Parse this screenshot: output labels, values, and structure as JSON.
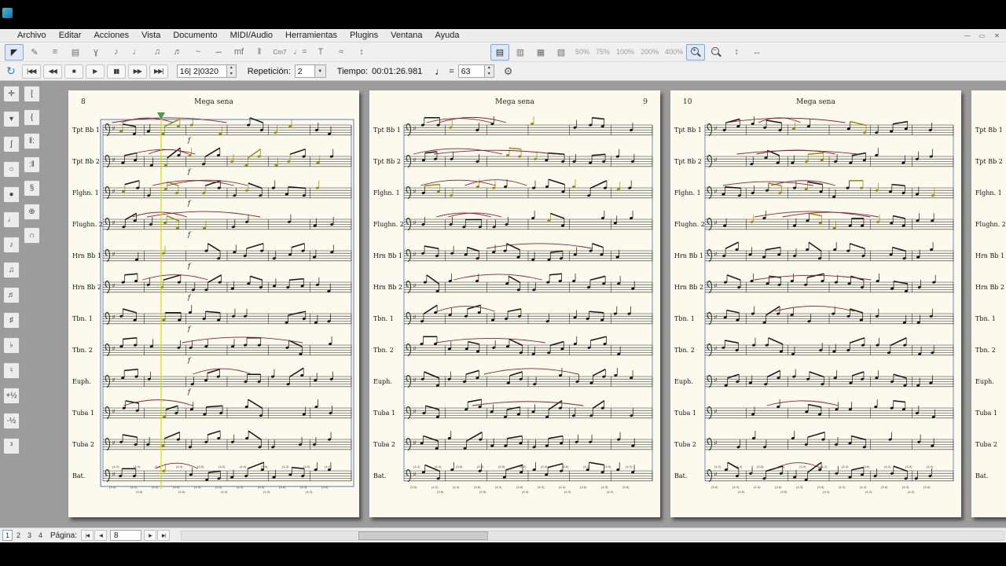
{
  "colors": {
    "accent": "#3d7bd7",
    "slur": "#8b2030",
    "note_highlight": "#9b8b00",
    "cursor_line": "#d6de00",
    "cursor_marker": "#3aa53a",
    "page_bg": "#fbfaec",
    "canvas_bg": "#9c9c9c"
  },
  "window": {
    "controls": [
      {
        "name": "minimize-button",
        "glyph": "—"
      },
      {
        "name": "restore-button",
        "glyph": "▭"
      },
      {
        "name": "close-button",
        "glyph": "✕"
      }
    ]
  },
  "menu": {
    "items": [
      "Archivo",
      "Editar",
      "Acciones",
      "Vista",
      "Documento",
      "MIDI/Audio",
      "Herramientas",
      "Plugins",
      "Ventana",
      "Ayuda"
    ]
  },
  "toolbar_main": {
    "left_icons": [
      {
        "name": "select-tool",
        "glyph": "◤",
        "active": true
      },
      {
        "name": "insert-tool",
        "glyph": "✎"
      },
      {
        "name": "align-tool",
        "glyph": "≡"
      },
      {
        "name": "staff-tool",
        "glyph": "▤"
      },
      {
        "name": "rest-tool",
        "glyph": "ɣ"
      },
      {
        "name": "note-tool",
        "glyph": "♪"
      },
      {
        "name": "grace-note-tool",
        "glyph": "♩"
      },
      {
        "name": "beam-tool",
        "glyph": "♫"
      },
      {
        "name": "tuplet-tool",
        "glyph": "♬"
      },
      {
        "name": "slur-tool",
        "glyph": "~"
      },
      {
        "name": "ornament-tool",
        "glyph": "∽"
      },
      {
        "name": "dynamics-tool",
        "glyph": "mf"
      },
      {
        "name": "barline-tool",
        "glyph": "‖"
      },
      {
        "name": "chord-tool",
        "glyph": "Cm7"
      },
      {
        "name": "tempo-tool",
        "glyph": "♩="
      },
      {
        "name": "text-tool",
        "glyph": "T"
      },
      {
        "name": "glissando-tool",
        "glyph": "≈"
      },
      {
        "name": "anchor-tool",
        "glyph": "↕"
      }
    ],
    "view_icons": [
      {
        "name": "score-layout-icon",
        "glyph": "▤",
        "active": true
      },
      {
        "name": "mixer-icon",
        "glyph": "▥"
      },
      {
        "name": "staff-view-icon",
        "glyph": "▦"
      },
      {
        "name": "page-view-icon",
        "glyph": "▧"
      }
    ],
    "zoom_presets": [
      "50%",
      "75%",
      "100%",
      "200%",
      "400%"
    ],
    "zoom_icons": [
      {
        "name": "zoom-in-icon",
        "type": "mag",
        "sign": "+",
        "active": true
      },
      {
        "name": "zoom-out-icon",
        "type": "mag",
        "sign": "−"
      },
      {
        "name": "fit-height-icon",
        "glyph": "↕"
      },
      {
        "name": "fit-width-icon",
        "glyph": "↔"
      }
    ]
  },
  "transport": {
    "loop_icon": "↻",
    "buttons": [
      {
        "name": "skip-start-button",
        "glyph": "|◀◀"
      },
      {
        "name": "rewind-button",
        "glyph": "◀◀"
      },
      {
        "name": "stop-button",
        "glyph": "■"
      },
      {
        "name": "play-button",
        "glyph": "▶"
      },
      {
        "name": "pause-button",
        "glyph": "▮▮"
      },
      {
        "name": "fast-forward-button",
        "glyph": "▶▶"
      },
      {
        "name": "skip-end-button",
        "glyph": "▶▶|"
      }
    ],
    "position_value": "16| 2|0320",
    "repeat_label": "Repetición:",
    "repeat_value": "2",
    "time_label": "Tiempo:",
    "time_value": "00:01:26.981",
    "tempo_note": "♩",
    "tempo_equals": "=",
    "tempo_value": "63",
    "settings_icon": "⚙"
  },
  "palette": {
    "col1": [
      {
        "name": "palette-select",
        "glyph": "✛"
      },
      {
        "name": "palette-marker",
        "glyph": "▾"
      },
      {
        "name": "palette-clef",
        "glyph": "ʃ"
      },
      {
        "name": "palette-whole-note",
        "glyph": "○"
      },
      {
        "name": "palette-half-note",
        "glyph": "●"
      },
      {
        "name": "palette-quarter-note",
        "glyph": "♩"
      },
      {
        "name": "palette-eighth-note",
        "glyph": "♪"
      },
      {
        "name": "palette-beamed-notes",
        "glyph": "♫"
      },
      {
        "name": "palette-sixteenth-notes",
        "glyph": "♬"
      },
      {
        "name": "palette-sharp",
        "glyph": "♯"
      },
      {
        "name": "palette-flat",
        "glyph": "♭"
      },
      {
        "name": "palette-natural",
        "glyph": "♮"
      },
      {
        "name": "palette-raise-half",
        "glyph": "+½"
      },
      {
        "name": "palette-lower-half",
        "glyph": "-½"
      },
      {
        "name": "palette-tuplet",
        "glyph": "³"
      }
    ],
    "col2": [
      {
        "name": "palette-bracket",
        "glyph": "["
      },
      {
        "name": "palette-brace",
        "glyph": "{"
      },
      {
        "name": "palette-repeat-start",
        "glyph": "‖:"
      },
      {
        "name": "palette-repeat-end",
        "glyph": ":‖"
      },
      {
        "name": "palette-segno",
        "glyph": "§"
      },
      {
        "name": "palette-coda",
        "glyph": "⊕"
      },
      {
        "name": "palette-fermata",
        "glyph": "∩"
      }
    ]
  },
  "score": {
    "title": "Mega sena",
    "dynamic_mark": "f",
    "instruments": [
      "Tpt Bb 1",
      "Tpt Bb 2",
      "Flghn. 1",
      "Flughn. 2",
      "Hrn Bb 1",
      "Hrn Bb 2",
      "Tbn. 1",
      "Tbn. 2",
      "Euph.",
      "Tuba 1",
      "Tuba 2",
      "Bat."
    ],
    "pages": [
      {
        "number": "8",
        "number_side": "left",
        "title": "Mega sena"
      },
      {
        "number": "9",
        "number_side": "right",
        "title": "Mega sena"
      },
      {
        "number": "10",
        "number_side": "left",
        "title": "Mega sena"
      }
    ],
    "drum_figures": [
      "(3-5)",
      "(4-2)",
      "(4-4)",
      "(3-6)",
      "(4-3)"
    ]
  },
  "statusbar": {
    "page_tabs": [
      "1",
      "2",
      "3",
      "4"
    ],
    "active_tab": "1",
    "page_label": "Página:",
    "nav_back": [
      {
        "name": "first-page-button",
        "glyph": "|◀"
      },
      {
        "name": "prev-page-button",
        "glyph": "◀"
      }
    ],
    "page_value": "8",
    "nav_forward": [
      {
        "name": "next-page-button",
        "glyph": "▶"
      },
      {
        "name": "last-page-button",
        "glyph": "▶|"
      }
    ]
  }
}
